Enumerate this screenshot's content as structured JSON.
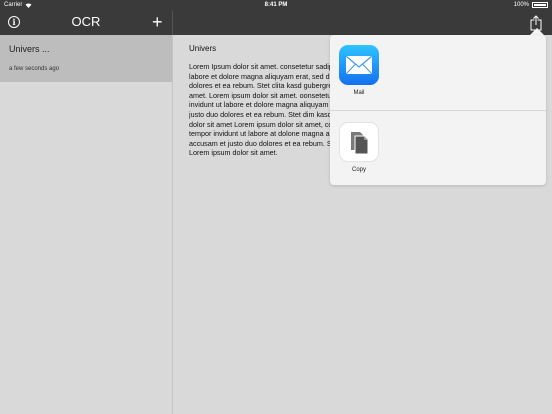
{
  "status_bar": {
    "carrier": "Carrier",
    "time": "8:41 PM",
    "battery": "100%"
  },
  "nav": {
    "title": "OCR",
    "info_glyph": "i",
    "add_glyph": "+"
  },
  "notes": [
    {
      "title": "Univers ...",
      "date": "a few seconds ago"
    }
  ],
  "document": {
    "title": "Univers",
    "lines": [
      "Lorem Ipsum dolor sit amet. consetetur sadipscing elitr, sed diam",
      "labore et dolore magna aliquyam erat, sed diam voluptua. At vero",
      "dolores et ea rebum. Stet clita kasd gubergren, no sea takimata",
      "amet. Lorem ipsum dolor sit amet. oonsetetur sadipscing elitr,",
      "invidunt ut labore et dolore magna aliquyam erat, sed diam",
      "justo duo dolores et ea rebum. Stet dim kasd gubergren, no sea",
      "dolor sit amet Lorem ipsum dolor sit amet, consetetur sadipscing",
      "tempor invidunt ut labore at dolone magna aliquyam erat, sed diam",
      "accusam et justo duo dolores et ea rebum. Stet clita kasd",
      "Lorem ipsum dolor sit amet."
    ]
  },
  "share": {
    "items": [
      {
        "label": "Mail",
        "icon": "mail-icon"
      },
      {
        "label": "Copy",
        "icon": "copy-icon"
      }
    ]
  },
  "colors": {
    "bar": "#3a3a3a",
    "background": "#d9d9d9",
    "selected_row": "#bdbdbd",
    "mail_gradient_top": "#2ec3ff",
    "mail_gradient_bottom": "#1570f0"
  }
}
